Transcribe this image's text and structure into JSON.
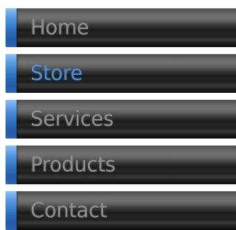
{
  "menu": {
    "items": [
      {
        "label": "Home",
        "active": false
      },
      {
        "label": "Store",
        "active": true
      },
      {
        "label": "Services",
        "active": false
      },
      {
        "label": "Products",
        "active": false
      },
      {
        "label": "Contact",
        "active": false
      }
    ]
  },
  "colors": {
    "accent": "#2f72c4",
    "active_text": "#4f8fd6",
    "inactive_text": "#8f8f8f",
    "bar_dark": "#1b1b1b",
    "background": "#ffffff"
  }
}
